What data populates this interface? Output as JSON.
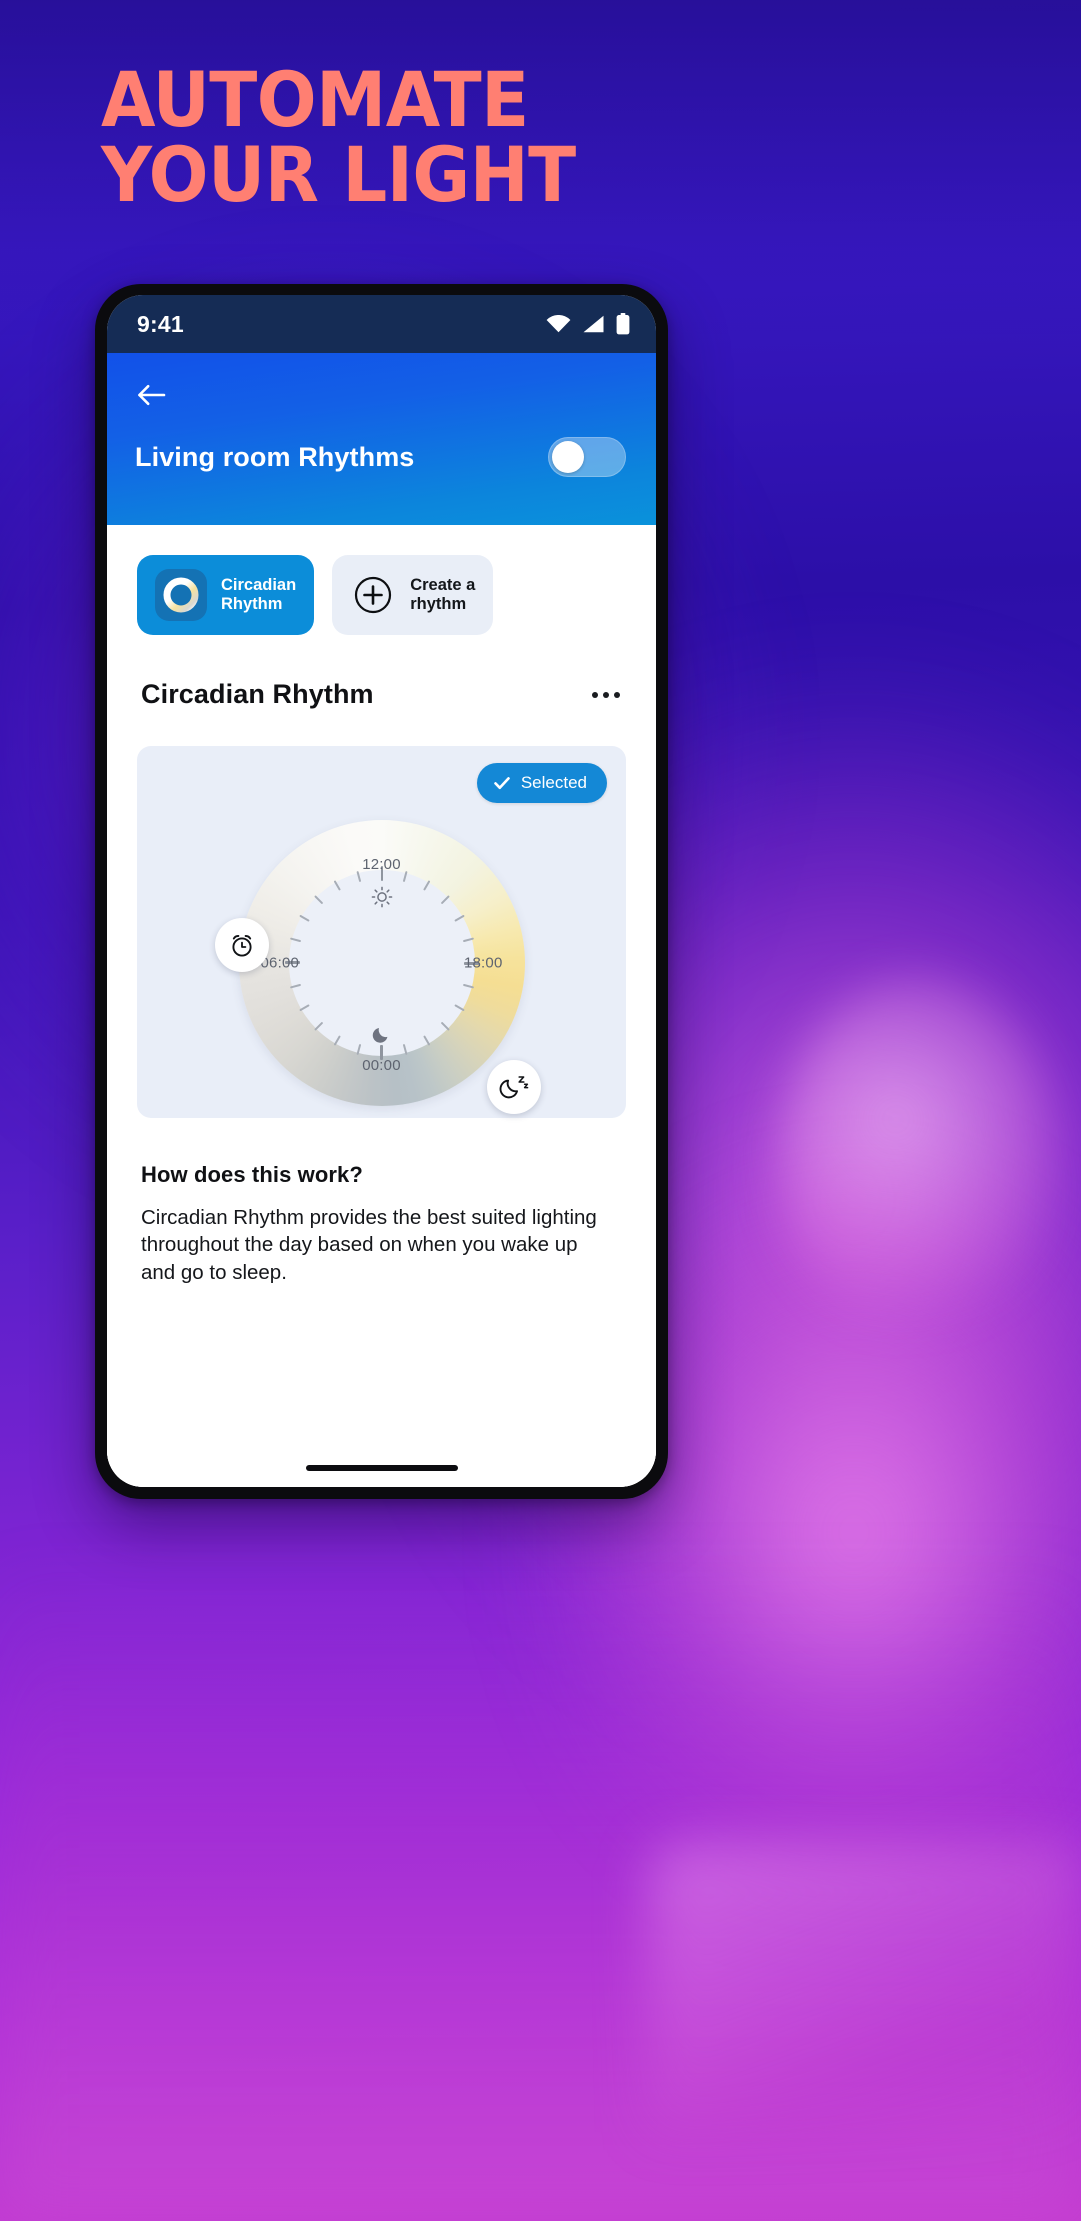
{
  "promo": {
    "headline_line1": "AUTOMATE",
    "headline_line2": "YOUR LIGHT",
    "headline_color": "#FF7F72",
    "background_colors": [
      "#2C0FA8",
      "#5A1FC9",
      "#9A2ADA",
      "#C33BD0"
    ]
  },
  "status_bar": {
    "time": "9:41",
    "background_color": "#152C55",
    "icons": [
      "wifi-icon",
      "cellular-signal-icon",
      "battery-icon"
    ]
  },
  "app_bar": {
    "back_icon": "arrow-left-icon",
    "title": "Living room Rhythms",
    "toggle_state": "off",
    "gradient_from": "#1251E9",
    "gradient_to": "#0A92DB"
  },
  "chips": [
    {
      "label_line1": "Circadian",
      "label_line2": "Rhythm",
      "icon": "circadian-ring-icon",
      "selected": true,
      "background_color": "#0C8DD9"
    },
    {
      "label_line1": "Create a",
      "label_line2": "rhythm",
      "icon": "plus-circle-icon",
      "selected": false,
      "background_color": "#E9EEF7"
    }
  ],
  "section": {
    "title": "Circadian Rhythm",
    "menu_icon": "overflow-menu-icon"
  },
  "dial_card": {
    "background_color": "#E9EEF8",
    "selected_badge": {
      "label": "Selected",
      "icon": "check-icon",
      "color": "#1488D6"
    },
    "clock": {
      "labels": {
        "top": "12:00",
        "right": "18:00",
        "bottom": "00:00",
        "left": "06:00"
      },
      "day_icon": "sun-icon",
      "night_icon": "moon-icon",
      "wake_handle_icon": "alarm-clock-icon",
      "sleep_handle_icon": "moon-zzz-icon",
      "tick_count": 24
    }
  },
  "explainer": {
    "heading": "How does this work?",
    "body": "Circadian Rhythm provides the best suited lighting throughout the day based on when you wake up and go to sleep."
  },
  "home_indicator": "home-indicator-bar"
}
